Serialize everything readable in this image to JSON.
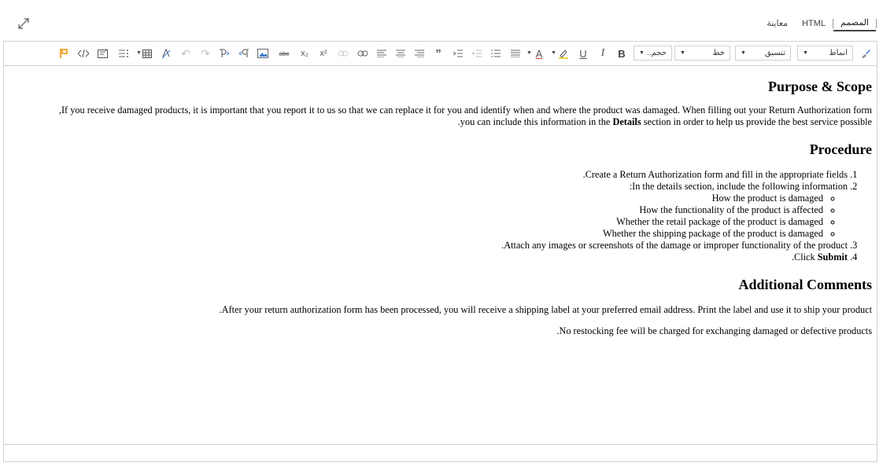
{
  "header": {
    "tabs": [
      {
        "label": "المصمم",
        "active": true
      },
      {
        "label": "HTML",
        "active": false
      },
      {
        "label": "معاينة",
        "active": false
      }
    ]
  },
  "toolbar": {
    "format_dropdown": "أنماط",
    "paragraph_dropdown": "تنسيق",
    "font_dropdown": "خط",
    "size_dropdown": "حجم...",
    "bold_label": "B",
    "italic_label": "I",
    "underline_label": "U",
    "font_color_label": "A",
    "subscript_label": "x₂",
    "superscript_label": "x²",
    "blockquote_label": "”",
    "strike_label": "abc"
  },
  "document": {
    "heading1": "Purpose & Scope",
    "para1_line1": "If you receive damaged products, it is important that you report it to us so that we can replace it for you and identify when and where the product was damaged. When filling out your Return Authorization form,",
    "para1_line2_pre": "you can include this information in the ",
    "para1_bold": "Details",
    "para1_line2_post": " section in order to help us provide the best service possible.",
    "heading2": "Procedure",
    "step1": "Create a Return Authorization form and fill in the appropriate fields.",
    "step2": "In the details section, include the following information:",
    "sub1": "How the product is damaged",
    "sub2": "How the functionality of the product is affected",
    "sub3": "Whether the retail package of the product is damaged",
    "sub4": "Whether the shipping package of the product is damaged",
    "step3": "Attach any images or screenshots of the damage or improper functionality of the product.",
    "step4_pre": "Click ",
    "step4_bold": "Submit",
    "step4_post": ".",
    "heading3": "Additional Comments",
    "para2": "After your return authorization form has been processed, you will receive a shipping label at your preferred email address. Print the label and use it to ship your product.",
    "para3": "No restocking fee will be charged for exchanging damaged or defective products."
  },
  "colors": {
    "border": "#d1d1d1",
    "icon": "#555555",
    "disabled_icon": "#c2c2c2",
    "flag_icon": "#f2a93b",
    "brush_icon": "#3a7bd5"
  }
}
